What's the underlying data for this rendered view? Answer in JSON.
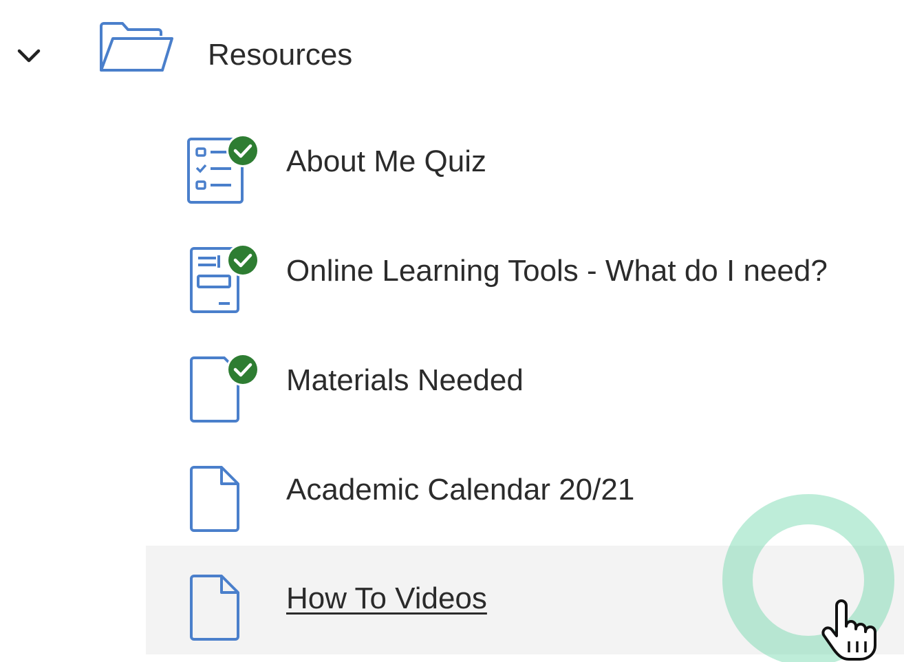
{
  "colors": {
    "icon_blue": "#4a7fcb",
    "check_green": "#2e7d32",
    "text": "#2b2b2b",
    "highlight_bg": "#f3f3f3",
    "cursor_ring": "#6ed7aa"
  },
  "folder": {
    "label": "Resources",
    "expanded": true,
    "toggle_icon": "chevron-down-icon",
    "icon": "folder-open-icon"
  },
  "items": [
    {
      "label": "About Me Quiz",
      "icon": "quiz-icon",
      "completed": true,
      "hovered": false
    },
    {
      "label": "Online Learning Tools - What do I need?",
      "icon": "form-document-icon",
      "completed": true,
      "hovered": false
    },
    {
      "label": "Materials Needed",
      "icon": "document-icon",
      "completed": true,
      "hovered": false
    },
    {
      "label": "Academic Calendar 20/21",
      "icon": "document-icon",
      "completed": false,
      "hovered": false
    },
    {
      "label": "How To Videos",
      "icon": "document-icon",
      "completed": false,
      "hovered": true
    }
  ]
}
